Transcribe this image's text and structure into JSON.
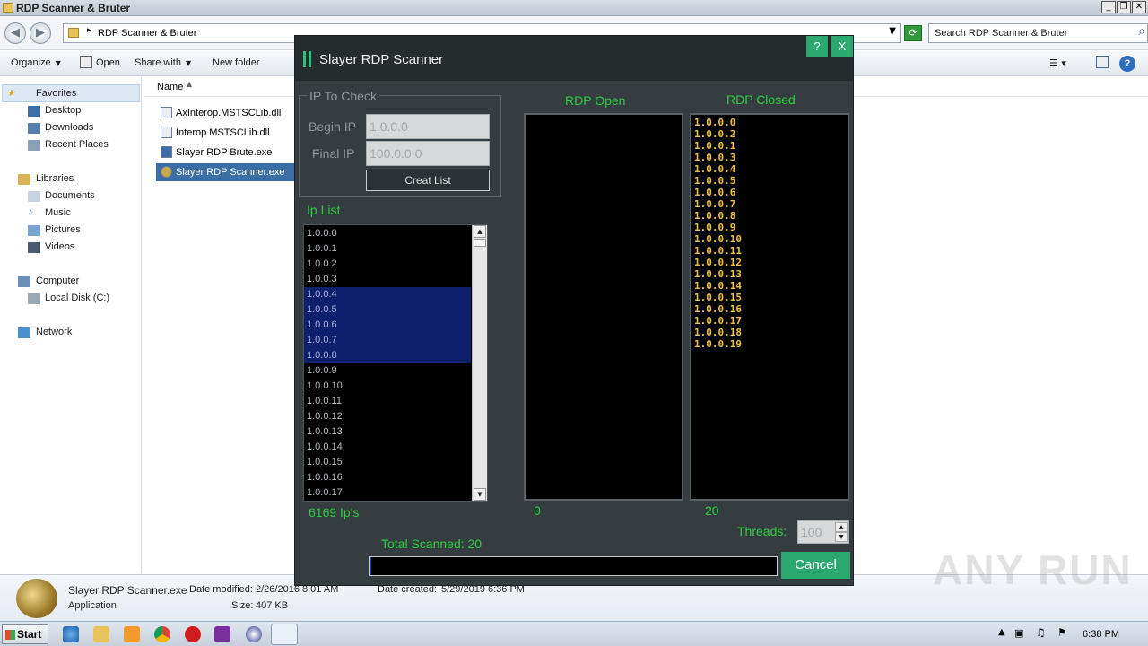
{
  "explorer": {
    "title": "RDP Scanner & Bruter",
    "address_path": "RDP Scanner & Bruter",
    "search_placeholder": "Search RDP Scanner & Bruter",
    "toolbar": {
      "organize": "Organize",
      "open": "Open",
      "share_with": "Share with",
      "new_folder": "New folder"
    },
    "nav": {
      "favorites": "Favorites",
      "desktop": "Desktop",
      "downloads": "Downloads",
      "recent_places": "Recent Places",
      "libraries": "Libraries",
      "documents": "Documents",
      "music": "Music",
      "pictures": "Pictures",
      "videos": "Videos",
      "computer": "Computer",
      "local_disk": "Local Disk (C:)",
      "network": "Network"
    },
    "column_name": "Name",
    "files": [
      "AxInterop.MSTSCLib.dll",
      "Interop.MSTSCLib.dll",
      "Slayer RDP Brute.exe",
      "Slayer RDP Scanner.exe"
    ],
    "details": {
      "filename": "Slayer RDP Scanner.exe",
      "type": "Application",
      "modified_label": "Date modified:",
      "modified": "2/26/2016 8:01 AM",
      "size_label": "Size:",
      "size": "407 KB",
      "created_label": "Date created:",
      "created": "5/29/2019 6:36 PM"
    }
  },
  "taskbar": {
    "start": "Start",
    "clock": "6:38 PM"
  },
  "scanner": {
    "title": "Slayer RDP Scanner",
    "help": "?",
    "close": "X",
    "group_title": "IP To Check",
    "begin_label": "Begin IP",
    "begin_value": "1.0.0.0",
    "final_label": "Final IP",
    "final_value": "100.0.0.0",
    "creat_list": "Creat List",
    "ip_list_label": "Ip List",
    "ip_list": [
      "1.0.0.0",
      "1.0.0.1",
      "1.0.0.2",
      "1.0.0.3",
      "1.0.0.4",
      "1.0.0.5",
      "1.0.0.6",
      "1.0.0.7",
      "1.0.0.8",
      "1.0.0.9",
      "1.0.0.10",
      "1.0.0.11",
      "1.0.0.12",
      "1.0.0.13",
      "1.0.0.14",
      "1.0.0.15",
      "1.0.0.16",
      "1.0.0.17"
    ],
    "ip_count": "6169 Ip's",
    "rdp_open_label": "RDP Open",
    "rdp_closed_label": "RDP Closed",
    "rdp_closed": [
      "1.0.0.0",
      "1.0.0.2",
      "1.0.0.1",
      "1.0.0.3",
      "1.0.0.4",
      "1.0.0.5",
      "1.0.0.6",
      "1.0.0.7",
      "1.0.0.8",
      "1.0.0.9",
      "1.0.0.10",
      "1.0.0.11",
      "1.0.0.12",
      "1.0.0.13",
      "1.0.0.14",
      "1.0.0.15",
      "1.0.0.16",
      "1.0.0.17",
      "1.0.0.18",
      "1.0.0.19"
    ],
    "open_count": "0",
    "closed_count": "20",
    "threads_label": "Threads:",
    "threads_value": "100",
    "total_scanned": "Total Scanned: 20",
    "progress_fraction": 0.004,
    "cancel": "Cancel"
  },
  "watermark": "ANY RUN"
}
